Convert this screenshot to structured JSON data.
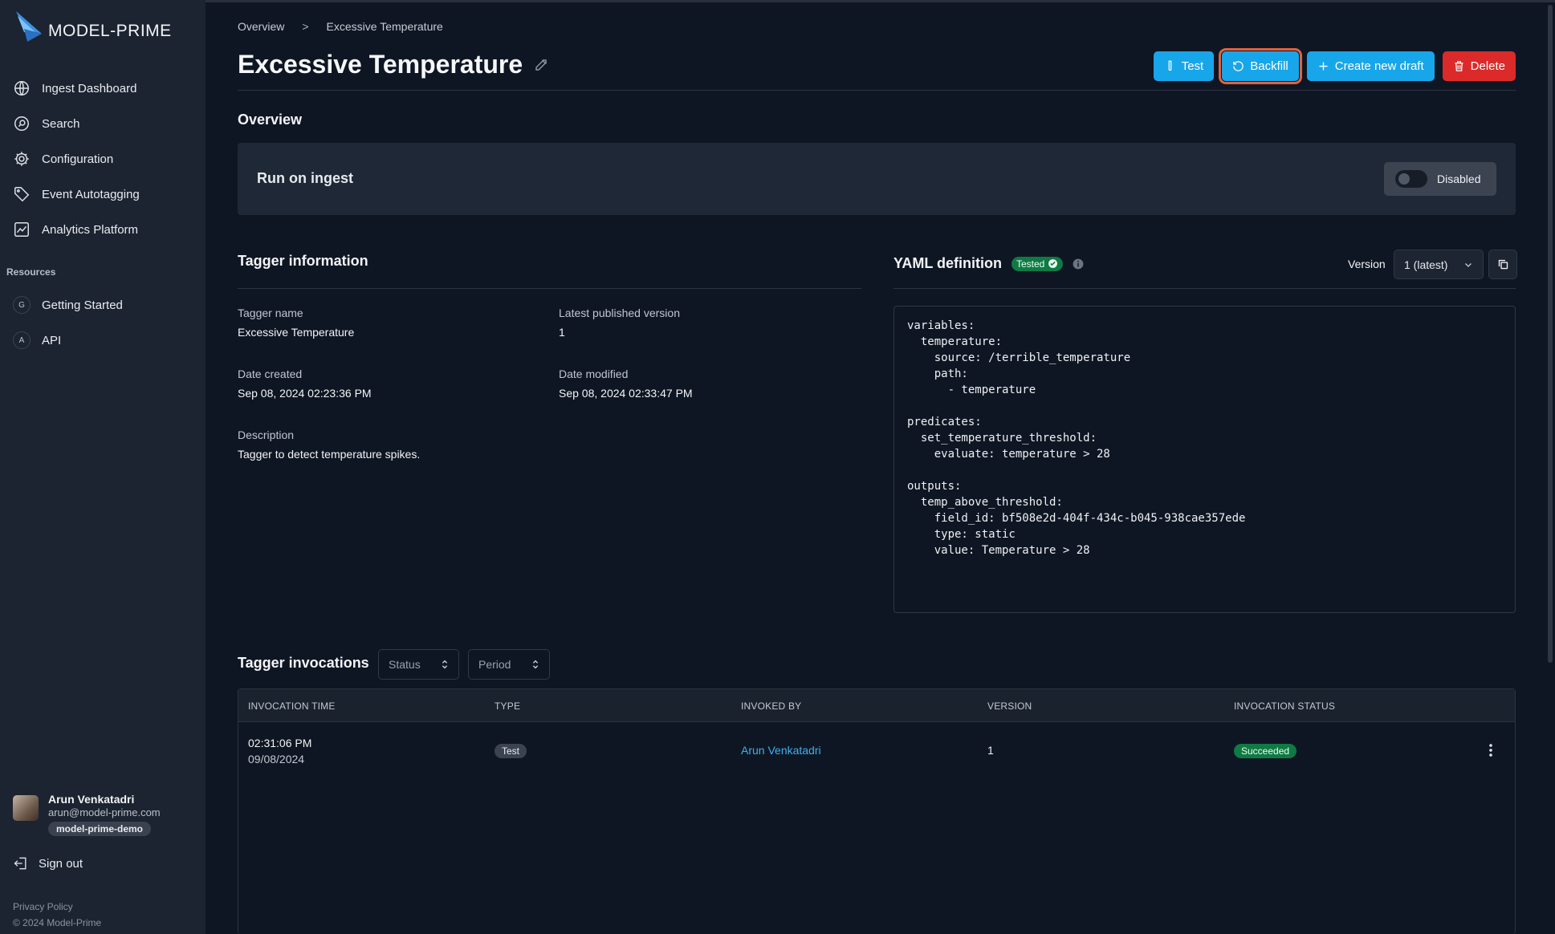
{
  "brand": {
    "name": "MODEL-PRIME"
  },
  "sidebar": {
    "items": [
      {
        "label": "Ingest Dashboard",
        "icon": "globe-icon"
      },
      {
        "label": "Search",
        "icon": "search-icon"
      },
      {
        "label": "Configuration",
        "icon": "gear-icon"
      },
      {
        "label": "Event Autotagging",
        "icon": "tag-icon"
      },
      {
        "label": "Analytics Platform",
        "icon": "chart-icon"
      }
    ],
    "resources_label": "Resources",
    "resources": [
      {
        "letter": "G",
        "label": "Getting Started"
      },
      {
        "letter": "A",
        "label": "API"
      }
    ],
    "user": {
      "name": "Arun Venkatadri",
      "email": "arun@model-prime.com",
      "org": "model-prime-demo"
    },
    "signout": "Sign out",
    "privacy": "Privacy Policy",
    "copyright": "© 2024 Model-Prime"
  },
  "breadcrumb": {
    "root": "Overview",
    "sep": ">",
    "current": "Excessive Temperature"
  },
  "page": {
    "title": "Excessive Temperature"
  },
  "actions": {
    "test": "Test",
    "backfill": "Backfill",
    "create": "Create new draft",
    "delete": "Delete"
  },
  "overview": {
    "heading": "Overview",
    "ingest_label": "Run on ingest",
    "toggle_state": "Disabled"
  },
  "tagger_info": {
    "heading": "Tagger information",
    "name_label": "Tagger name",
    "name": "Excessive Temperature",
    "version_label": "Latest published version",
    "version": "1",
    "created_label": "Date created",
    "created": "Sep 08, 2024 02:23:36 PM",
    "modified_label": "Date modified",
    "modified": "Sep 08, 2024 02:33:47 PM",
    "desc_label": "Description",
    "desc": "Tagger to detect temperature spikes."
  },
  "yaml": {
    "heading": "YAML definition",
    "badge": "Tested",
    "version_label": "Version",
    "version_value": "1 (latest)",
    "content": "variables:\n  temperature:\n    source: /terrible_temperature\n    path:\n      - temperature\n\npredicates:\n  set_temperature_threshold:\n    evaluate: temperature > 28\n\noutputs:\n  temp_above_threshold:\n    field_id: bf508e2d-404f-434c-b045-938cae357ede\n    type: static\n    value: Temperature > 28"
  },
  "invocations": {
    "heading": "Tagger invocations",
    "status_filter": "Status",
    "period_filter": "Period",
    "columns": [
      "INVOCATION TIME",
      "TYPE",
      "INVOKED BY",
      "VERSION",
      "INVOCATION STATUS"
    ],
    "rows": [
      {
        "time": "02:31:06 PM",
        "date": "09/08/2024",
        "type": "Test",
        "invoked_by": "Arun Venkatadri",
        "version": "1",
        "status": "Succeeded"
      }
    ]
  },
  "colors": {
    "accent": "#18a6ea",
    "danger": "#dc2a2a",
    "success": "#0f7a43",
    "focus": "#e3613d"
  }
}
